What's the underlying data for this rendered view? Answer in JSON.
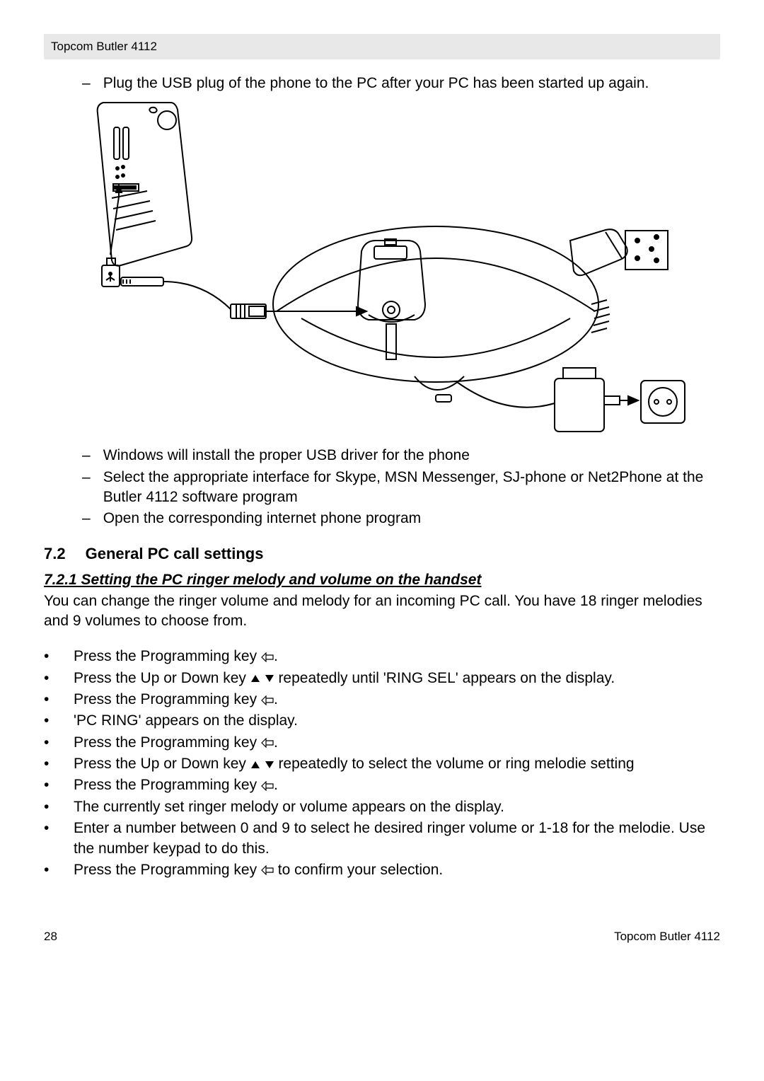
{
  "header": {
    "product": "Topcom Butler 4112"
  },
  "intro": {
    "item1": "Plug the USB plug of the phone to the PC after your PC has been started up again.",
    "after1": "Windows will install the proper USB driver for the phone",
    "after2": "Select the appropriate interface for Skype, MSN Messenger, SJ-phone or Net2Phone at the Butler 4112 software program",
    "after3": "Open the corresponding internet phone program"
  },
  "section": {
    "num": "7.2",
    "title": "General PC call settings"
  },
  "sub": {
    "num_title": "7.2.1 Setting the PC ringer melody and volume on the handset",
    "para": "You can change the ringer volume and melody for an incoming PC call. You have 18 ringer melodies and 9 volumes to choose from."
  },
  "steps": {
    "s1a": "Press the Programming key ",
    "s1b": ".",
    "s2a": "Press the Up or Down key ",
    "s2b": " repeatedly until 'RING SEL' appears on the display.",
    "s3a": "Press the Programming key ",
    "s3b": ".",
    "s4": "'PC RING' appears on the display.",
    "s5a": "Press the Programming key ",
    "s5b": ".",
    "s6a": "Press the Up or Down key ",
    "s6b": " repeatedly to select the volume or ring melodie setting",
    "s7a": "Press the Programming key ",
    "s7b": ".",
    "s8": "The currently set ringer melody or volume appears on the display.",
    "s9": "Enter a number between 0 and 9 to select he desired ringer volume or 1-18 for the melodie. Use the number keypad to do this.",
    "s10a": "Press the Programming key ",
    "s10b": " to confirm your selection."
  },
  "footer": {
    "page": "28",
    "product": "Topcom Butler 4112"
  }
}
